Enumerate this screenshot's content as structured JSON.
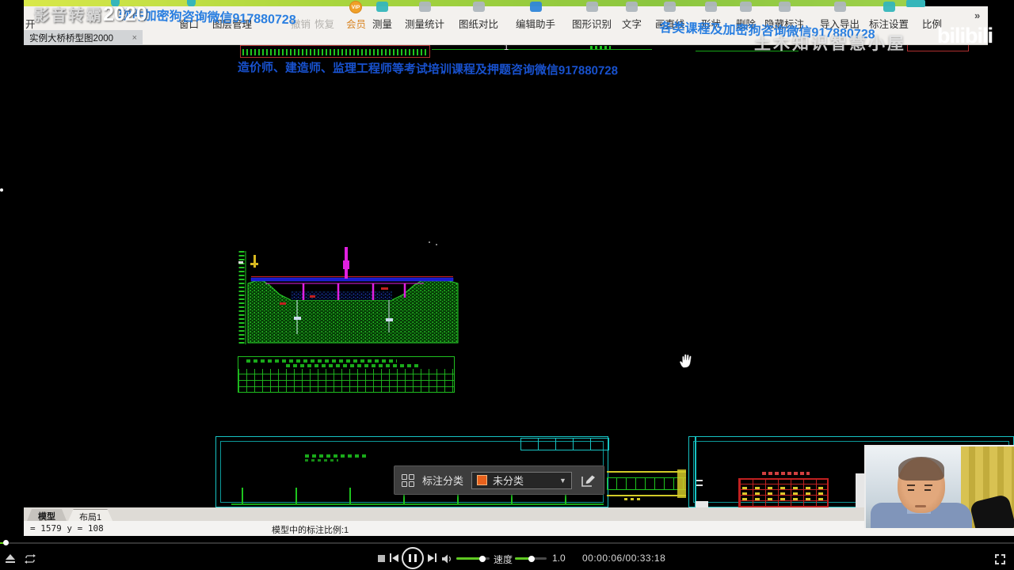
{
  "watermarks": {
    "brand_name": "影音转霸",
    "brand_year": "2020",
    "wechat_top_left": "软件加密狗咨询微信917880728",
    "wechat_top_right": "各类课程及加密狗咨询微信917880728",
    "wechat_canvas": "造价师、建造师、监理工程师等考试培训课程及押题咨询微信917880728",
    "channel_name": "土木知识智慧小屋",
    "site_logo": "bilibili"
  },
  "toolbar": {
    "open_label": "开",
    "items": [
      "窗口",
      "图层管理",
      "撤销",
      "恢复",
      "会员",
      "测量",
      "测量统计",
      "图纸对比",
      "编辑助手",
      "图形识别",
      "文字",
      "画直线",
      "形状",
      "删除",
      "隐藏标注",
      "导入导出",
      "标注设置",
      "比例"
    ],
    "overflow_label": "»"
  },
  "document_tab": {
    "title": "实例大桥桥型图2000",
    "close_label": "×"
  },
  "canvas": {
    "marker_label": "1"
  },
  "classify_panel": {
    "title": "标注分类",
    "selected_option": "未分类",
    "swatch_color": "#e8611c",
    "caret": "▼"
  },
  "statusbar": {
    "model_tab": "模型",
    "layout_tab": "布局1",
    "coordinates": "= 1579  y = 108",
    "annotation_scale": "模型中的标注比例:1"
  },
  "player": {
    "speed_label": "速度",
    "speed_value": "1.0",
    "time": "00:00:06/00:33:18"
  },
  "colors": {
    "accent_blue_watermark": "#2079e0",
    "cad_green": "#1ec41e",
    "cad_cyan": "#17c3c3",
    "cad_magenta": "#e020e0",
    "cad_red": "#c02020",
    "player_green": "#5fc922",
    "swatch_orange": "#e8611c",
    "vip_orange": "#f0a028"
  }
}
